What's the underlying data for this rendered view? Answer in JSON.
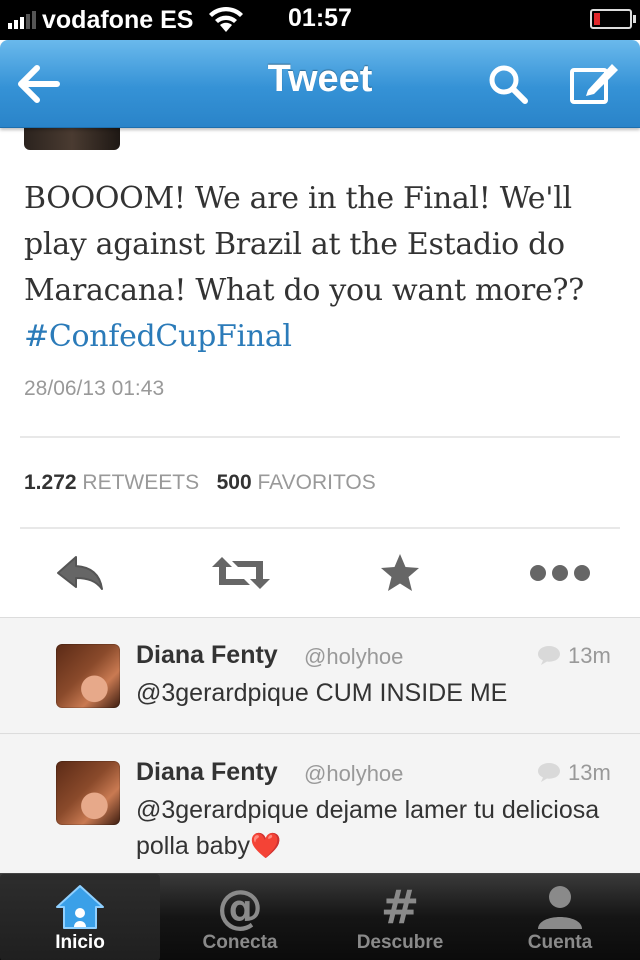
{
  "status_bar": {
    "carrier": "vodafone ES",
    "time": "01:57"
  },
  "nav": {
    "title": "Tweet",
    "back_icon": "back-arrow-icon",
    "search_icon": "search-icon",
    "compose_icon": "compose-icon"
  },
  "tweet": {
    "text": "BOOOOM! We are in the Final! We'll play against Brazil at the Estadio do Maracana! What do you want more?? ",
    "hashtag": "#ConfedCupFinal",
    "date": "28/06/13 01:43",
    "retweets_count": "1.272",
    "retweets_label": "RETWEETS",
    "favorites_count": "500",
    "favorites_label": "FAVORITOS"
  },
  "actions": [
    {
      "icon": "reply-icon"
    },
    {
      "icon": "retweet-icon"
    },
    {
      "icon": "favorite-star-icon"
    },
    {
      "icon": "more-icon"
    }
  ],
  "replies": [
    {
      "name": "Diana Fenty",
      "handle": "@holyhoe",
      "time": "13m",
      "text": "@3gerardpique CUM INSIDE ME"
    },
    {
      "name": "Diana Fenty",
      "handle": "@holyhoe",
      "time": "13m",
      "text": "@3gerardpique  dejame lamer tu deliciosa polla baby",
      "emoji": "❤️"
    }
  ],
  "tabs": [
    {
      "label": "Inicio",
      "icon": "home-icon",
      "active": true
    },
    {
      "label": "Conecta",
      "icon": "at-icon",
      "active": false
    },
    {
      "label": "Descubre",
      "icon": "hash-icon",
      "active": false
    },
    {
      "label": "Cuenta",
      "icon": "person-icon",
      "active": false
    }
  ],
  "colors": {
    "accent": "#2b7bb9",
    "nav_blue": "#3592d6",
    "battery_low": "#e0262a"
  }
}
